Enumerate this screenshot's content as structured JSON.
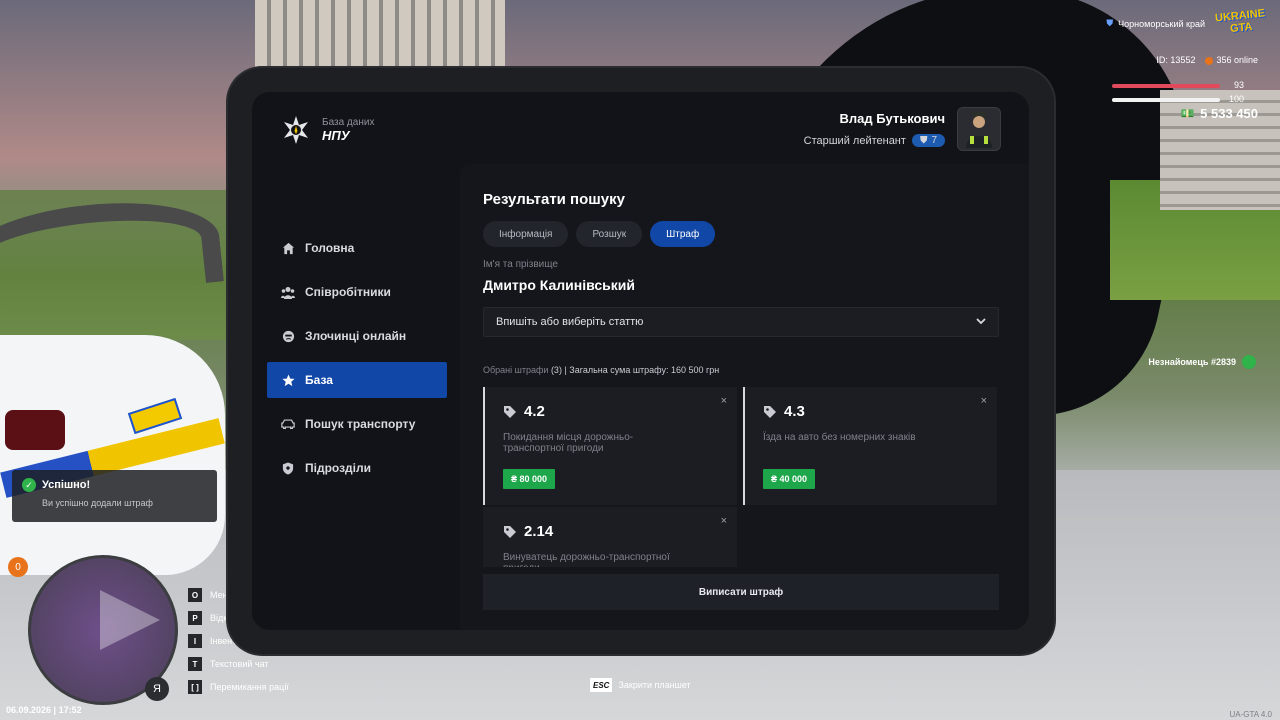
{
  "sidebar": {
    "logo_sub": "База даних",
    "logo_title": "НПУ",
    "items": [
      {
        "label": "Головна",
        "icon": "home-icon"
      },
      {
        "label": "Співробітники",
        "icon": "users-icon"
      },
      {
        "label": "Злочинці онлайн",
        "icon": "criminal-icon"
      },
      {
        "label": "База",
        "icon": "star-icon",
        "active": true
      },
      {
        "label": "Пошук транспорту",
        "icon": "car-icon"
      },
      {
        "label": "Підрозділи",
        "icon": "shield-icon"
      }
    ]
  },
  "user": {
    "name": "Влад Бутькович",
    "rank": "Старший лейтенант",
    "rank_level": "7"
  },
  "content": {
    "title": "Результати пошуку",
    "tabs": [
      "Інформація",
      "Розшук",
      "Штраф"
    ],
    "active_tab": "Штраф",
    "name_label": "Ім'я та прізвище",
    "name_value": "Дмитро Калинівський",
    "select_placeholder": "Впишіть або виберіть статтю",
    "summary_prefix": "Обрані штрафи",
    "summary_count": "(3)",
    "summary_total": "| Загальна сума штрафу: 160 500 грн",
    "fines": [
      {
        "article": "4.2",
        "desc": "Покидання місця дорожньо-транспортної пригоди",
        "price": "₴ 80 000"
      },
      {
        "article": "4.3",
        "desc": "Їзда на авто без номерних знаків",
        "price": "₴ 40 000"
      },
      {
        "article": "2.14",
        "desc": "Винуватець дорожньо-транспортної пригоди",
        "price": ""
      }
    ],
    "close_symbol": "×",
    "submit_label": "Виписати штраф"
  },
  "hud": {
    "region": "Чорноморський край",
    "game_logo_line1": "UKRAINE",
    "game_logo_line2": "GTA",
    "player_id": "ID: 13552",
    "online": "356 online",
    "health": "93",
    "armor": "100",
    "money": "5 533 450",
    "stranger": "Незнайомець #2839",
    "notification_title": "Успішно!",
    "notification_text": "Ви успішно додали штраф",
    "skill_badge": "0",
    "mic_label": "Я",
    "keys": [
      {
        "key": "O",
        "label": "Мені"
      },
      {
        "key": "P",
        "label": "Відк"
      },
      {
        "key": "I",
        "label": "Інвент"
      },
      {
        "key": "T",
        "label": "Текстовий чат"
      },
      {
        "key": "[ ]",
        "label": "Перемикання рації"
      }
    ],
    "datetime": "06.09.2026 | 17:52",
    "esc_key": "ESC",
    "esc_label": "Закрити планшет",
    "version": "UA-GTA 4.0"
  },
  "colors": {
    "accent": "#1147a6",
    "price_green": "#1ea64a",
    "panel_bg": "#121318",
    "content_bg": "#15161c"
  }
}
